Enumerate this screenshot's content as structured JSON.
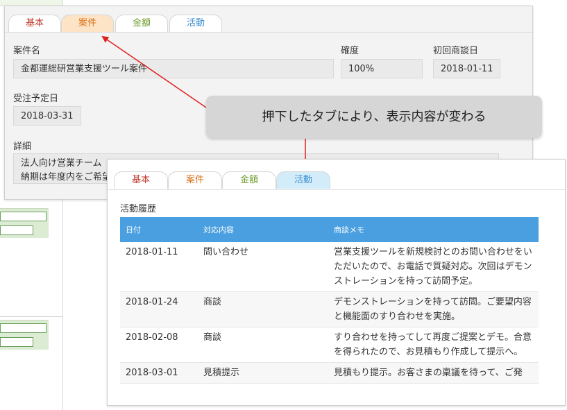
{
  "back_panel": {
    "tabs": [
      {
        "label": "基本"
      },
      {
        "label": "案件"
      },
      {
        "label": "金額"
      },
      {
        "label": "活動"
      }
    ],
    "active_tab": "案件",
    "fields": {
      "case_name_label": "案件名",
      "case_name_value": "金都運総研営業支援ツール案件",
      "certainty_label": "確度",
      "certainty_value": "100%",
      "first_meeting_label": "初回商談日",
      "first_meeting_value": "2018-01-11",
      "order_date_label": "受注予定日",
      "order_date_value": "2018-03-31",
      "detail_label": "詳細",
      "detail_line1": "法人向け営業チーム",
      "detail_line2": "納期は年度内をご希望"
    }
  },
  "callout": {
    "text": "押下したタブにより、表示内容が変わる"
  },
  "front_panel": {
    "tabs": [
      {
        "label": "基本"
      },
      {
        "label": "案件"
      },
      {
        "label": "金額"
      },
      {
        "label": "活動"
      }
    ],
    "active_tab": "活動",
    "history_title": "活動履歴",
    "columns": [
      "日付",
      "対応内容",
      "商談メモ"
    ],
    "rows": [
      {
        "date": "2018-01-11",
        "type": "問い合わせ",
        "memo": "営業支援ツールを新規検討とのお問い合わせをいただいたので、お電話で質疑対応。次回はデモンストレーションを持って訪問予定。"
      },
      {
        "date": "2018-01-24",
        "type": "商談",
        "memo": "デモンストレーションを持って訪問。ご要望内容と機能面のすり合わせを実施。"
      },
      {
        "date": "2018-02-08",
        "type": "商談",
        "memo": "すり合わせを持ってして再度ご提案とデモ。合意を得られたので、お見積もり作成して提示へ。"
      },
      {
        "date": "2018-03-01",
        "type": "見積提示",
        "memo": "見積もり提示。お客さまの稟議を待って、ご発"
      }
    ]
  },
  "colors": {
    "tab_kihon": "#c0392b",
    "tab_anken": "#d9731b",
    "tab_kingaku": "#6a9a27",
    "tab_katsudo": "#3d8fd0",
    "table_header": "#4a9fe0",
    "arrow": "#e02020"
  }
}
